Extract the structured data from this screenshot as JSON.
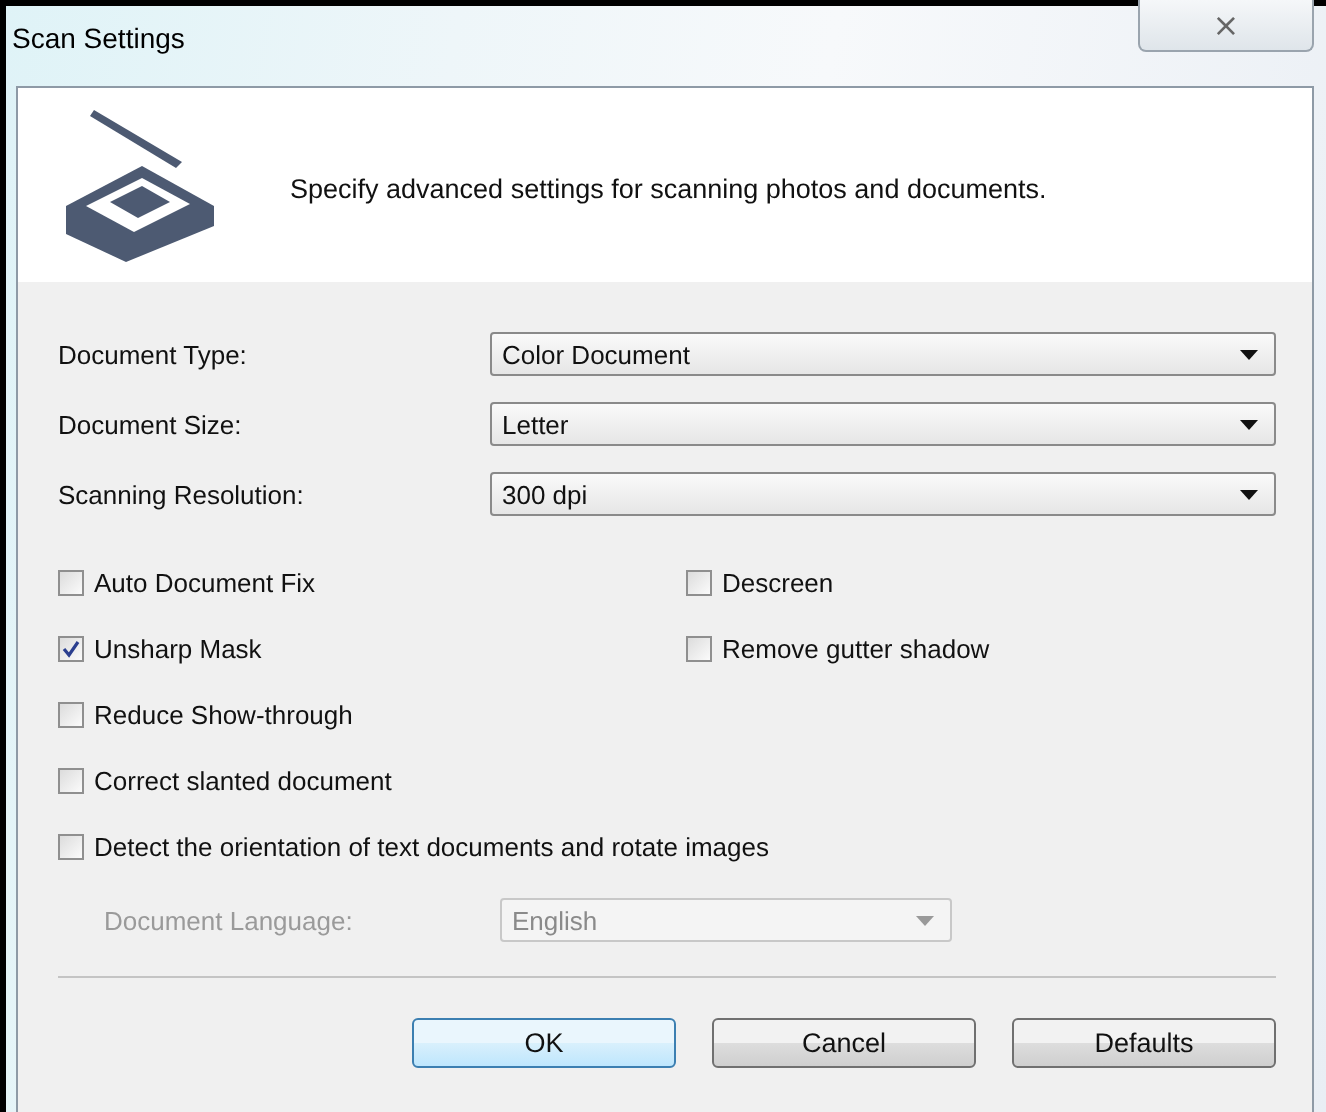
{
  "window": {
    "title": "Scan Settings",
    "close_label": "⨯"
  },
  "header": {
    "description": "Specify advanced settings for scanning photos and documents."
  },
  "selects": [
    {
      "label": "Document Type:",
      "value": "Color Document"
    },
    {
      "label": "Document Size:",
      "value": "Letter"
    },
    {
      "label": "Scanning Resolution:",
      "value": "300 dpi"
    }
  ],
  "option_rows": [
    [
      {
        "label": "Auto Document Fix",
        "checked": false
      },
      {
        "label": "Descreen",
        "checked": false
      }
    ],
    [
      {
        "label": "Unsharp Mask",
        "checked": true
      },
      {
        "label": "Remove gutter shadow",
        "checked": false
      }
    ],
    [
      {
        "label": "Reduce Show-through",
        "checked": false
      }
    ],
    [
      {
        "label": "Correct slanted document",
        "checked": false
      }
    ],
    [
      {
        "label": "Detect the orientation of text documents and rotate images",
        "checked": false
      }
    ]
  ],
  "language": {
    "label": "Document Language:",
    "value": "English",
    "disabled": true
  },
  "buttons": [
    {
      "label": "OK",
      "default": true
    },
    {
      "label": "Cancel",
      "default": false
    },
    {
      "label": "Defaults",
      "default": false
    }
  ]
}
